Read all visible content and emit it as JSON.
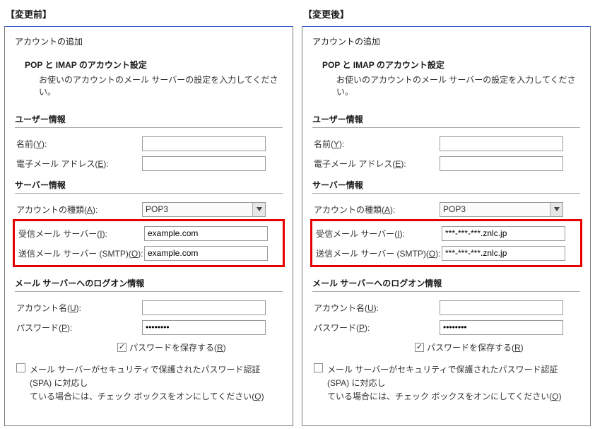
{
  "columns": {
    "before": {
      "title": "【変更前】",
      "servers": {
        "incoming": "example.com",
        "outgoing": "example.com"
      }
    },
    "after": {
      "title": "【変更後】",
      "servers": {
        "incoming": "***-***-***.znlc.jp",
        "outgoing": "***-***-***.znlc.jp"
      }
    }
  },
  "dlg": {
    "title": "アカウントの追加",
    "intro_heading": "POP と IMAP のアカウント設定",
    "intro_desc": "お使いのアカウントのメール サーバーの設定を入力してください。",
    "sections": {
      "user": "ユーザー情報",
      "server": "サーバー情報",
      "logon": "メール サーバーへのログオン情報"
    },
    "labels": {
      "name_pre": "名前(",
      "name_key": "Y",
      "name_post": "):",
      "email_pre": "電子メール アドレス(",
      "email_key": "E",
      "email_post": "):",
      "acct_type_pre": "アカウントの種類(",
      "acct_type_key": "A",
      "acct_type_post": "):",
      "incoming_pre": "受信メール サーバー(",
      "incoming_key": "I",
      "incoming_post": "):",
      "outgoing_pre": "送信メール サーバー (SMTP)(",
      "outgoing_key": "O",
      "outgoing_post": "):",
      "acct_name_pre": "アカウント名(",
      "acct_name_key": "U",
      "acct_name_post": "):",
      "password_pre": "パスワード(",
      "password_key": "P",
      "password_post": "):"
    },
    "account_type_value": "POP3",
    "password_value": "********",
    "remember_pw_pre": "パスワードを保存する(",
    "remember_pw_key": "R",
    "remember_pw_post": ")",
    "spa_line1": "メール サーバーがセキュリティで保護されたパスワード認証 (SPA) に対応し",
    "spa_line2_pre": "ている場合には、チェック ボックスをオンにしてください(",
    "spa_line2_key": "Q",
    "spa_line2_post": ")"
  }
}
